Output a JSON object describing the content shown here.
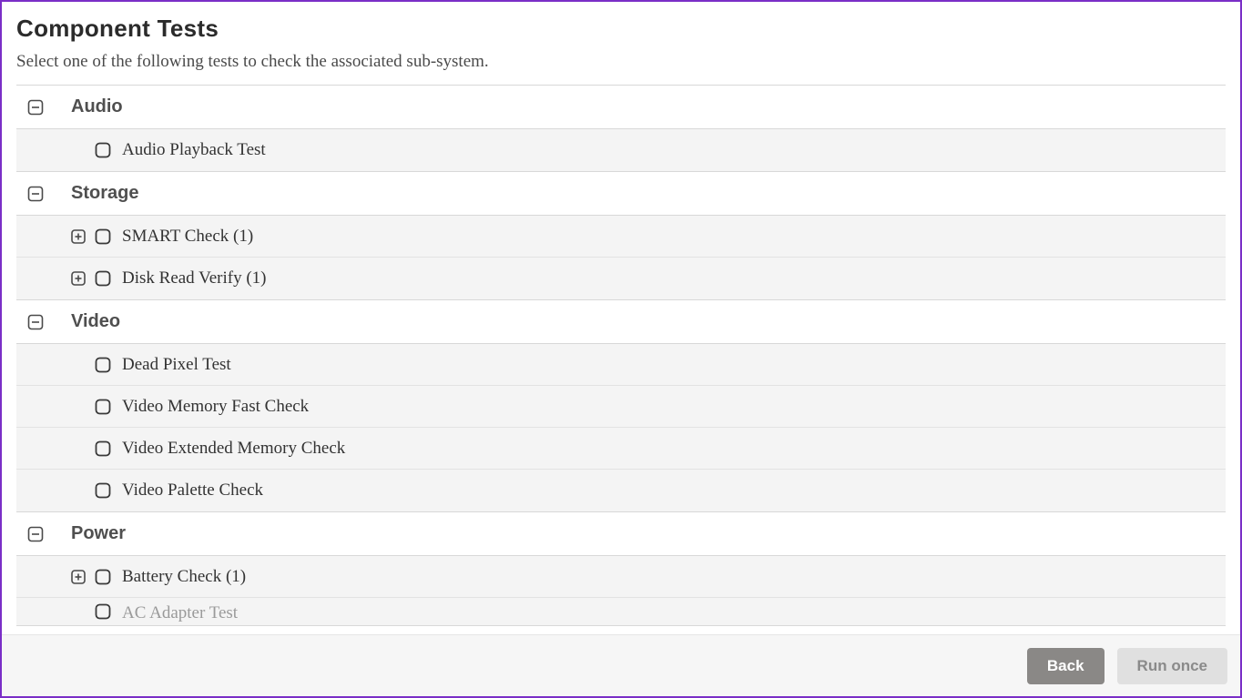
{
  "title": "Component Tests",
  "subtitle": "Select one of the following tests to check the associated sub-system.",
  "categories": [
    {
      "name": "Audio",
      "tests": [
        {
          "label": "Audio Playback Test",
          "expandable": false
        }
      ]
    },
    {
      "name": "Storage",
      "tests": [
        {
          "label": "SMART Check (1)",
          "expandable": true
        },
        {
          "label": "Disk Read Verify (1)",
          "expandable": true
        }
      ]
    },
    {
      "name": "Video",
      "tests": [
        {
          "label": "Dead Pixel Test",
          "expandable": false
        },
        {
          "label": "Video Memory Fast Check",
          "expandable": false
        },
        {
          "label": "Video Extended Memory Check",
          "expandable": false
        },
        {
          "label": "Video Palette Check",
          "expandable": false
        }
      ]
    },
    {
      "name": "Power",
      "tests": [
        {
          "label": "Battery Check (1)",
          "expandable": true
        },
        {
          "label": "AC Adapter Test",
          "expandable": false,
          "cutoff": true
        }
      ]
    }
  ],
  "footer": {
    "back": "Back",
    "run": "Run once"
  }
}
